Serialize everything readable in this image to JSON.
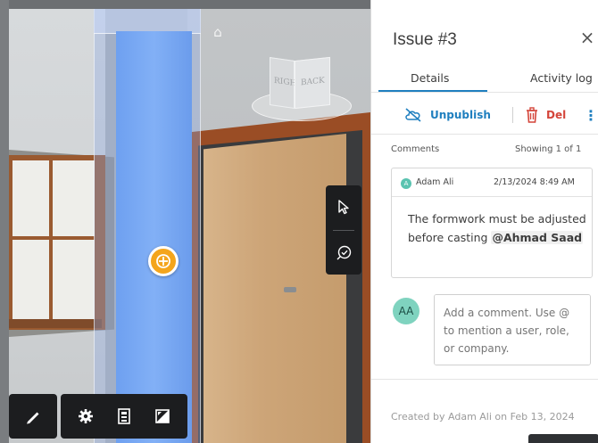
{
  "viewport": {
    "view_cube": {
      "left_face": "RIGHT",
      "right_face": "BACK"
    },
    "side_tools": [
      {
        "name": "select-pointer-icon"
      },
      {
        "name": "issue-check-icon"
      }
    ],
    "toolbar_left": [
      {
        "name": "markup-pen-icon"
      }
    ],
    "toolbar_right": [
      {
        "name": "settings-icon"
      },
      {
        "name": "model-browser-icon"
      },
      {
        "name": "fullscreen-icon"
      }
    ]
  },
  "panel": {
    "title": "Issue #3",
    "tabs": [
      {
        "label": "Details",
        "active": true
      },
      {
        "label": "Activity log",
        "active": false
      }
    ],
    "actions": {
      "unpublish_label": "Unpublish",
      "delete_label": "Del"
    },
    "comments": {
      "label": "Comments",
      "showing": "Showing 1 of 1",
      "items": [
        {
          "author_initial": "A",
          "author": "Adam Ali",
          "date": "2/13/2024 8:49 AM",
          "text": "The formwork must be adjusted before casting ",
          "mention": "@Ahmad Saad"
        }
      ]
    },
    "composer": {
      "avatar_initials": "AA",
      "placeholder": "Add a comment. Use @ to mention a user, role, or company."
    },
    "created_by": "Created by Adam Ali on Feb 13, 2024"
  },
  "colors": {
    "accent": "#1f7fbf",
    "danger": "#d4453a",
    "pin": "#f4a51c",
    "column": "#6ea0f0"
  }
}
